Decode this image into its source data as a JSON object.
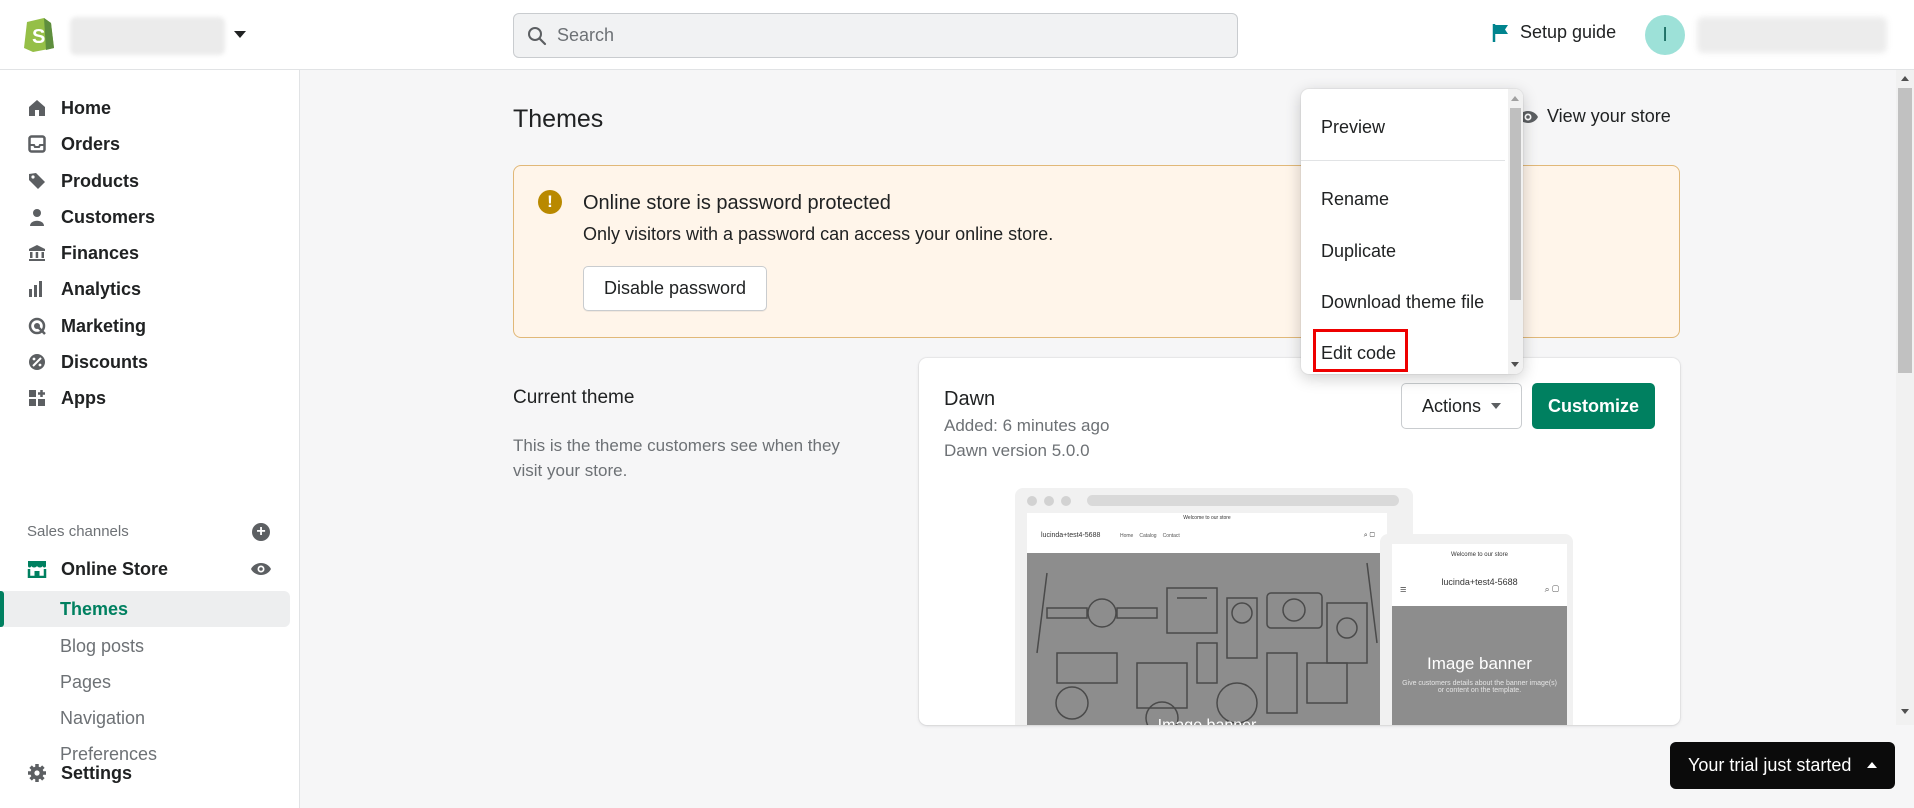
{
  "topbar": {
    "search_placeholder": "Search",
    "setup_guide": "Setup guide",
    "avatar_initial": "I"
  },
  "sidebar": {
    "items": [
      {
        "label": "Home",
        "icon": "home-icon"
      },
      {
        "label": "Orders",
        "icon": "inbox-icon"
      },
      {
        "label": "Products",
        "icon": "tag-icon"
      },
      {
        "label": "Customers",
        "icon": "person-icon"
      },
      {
        "label": "Finances",
        "icon": "bank-icon"
      },
      {
        "label": "Analytics",
        "icon": "bar-chart-icon"
      },
      {
        "label": "Marketing",
        "icon": "target-icon"
      },
      {
        "label": "Discounts",
        "icon": "discount-icon"
      },
      {
        "label": "Apps",
        "icon": "apps-icon"
      }
    ],
    "sales_channels_label": "Sales channels",
    "online_store": "Online Store",
    "sub_items": [
      "Themes",
      "Blog posts",
      "Pages",
      "Navigation",
      "Preferences"
    ],
    "settings": "Settings"
  },
  "main": {
    "title": "Themes",
    "view_store": "View your store",
    "banner": {
      "title": "Online store is password protected",
      "text": "Only visitors with a password can access your online store.",
      "button": "Disable password"
    },
    "current_theme": {
      "heading": "Current theme",
      "description": "This is the theme customers see when they visit your store.",
      "name": "Dawn",
      "added": "Added: 6 minutes ago",
      "version": "Dawn version 5.0.0",
      "actions": "Actions",
      "customize": "Customize"
    },
    "preview": {
      "announcement": "Welcome to our store",
      "store_name": "lucinda+test4-5688",
      "links": [
        "Home",
        "Catalog",
        "Contact"
      ],
      "banner_label": "Image banner",
      "mobile_sub": "Give customers details about the banner image(s) or content on the template."
    }
  },
  "actions_menu": {
    "items": [
      "Preview",
      "Rename",
      "Duplicate",
      "Download theme file",
      "Edit code"
    ]
  },
  "trial": "Your trial just started",
  "colors": {
    "primary": "#008060",
    "banner_bg": "#fff5ea",
    "banner_border": "#e1b878",
    "highlight": "#ee0000"
  }
}
